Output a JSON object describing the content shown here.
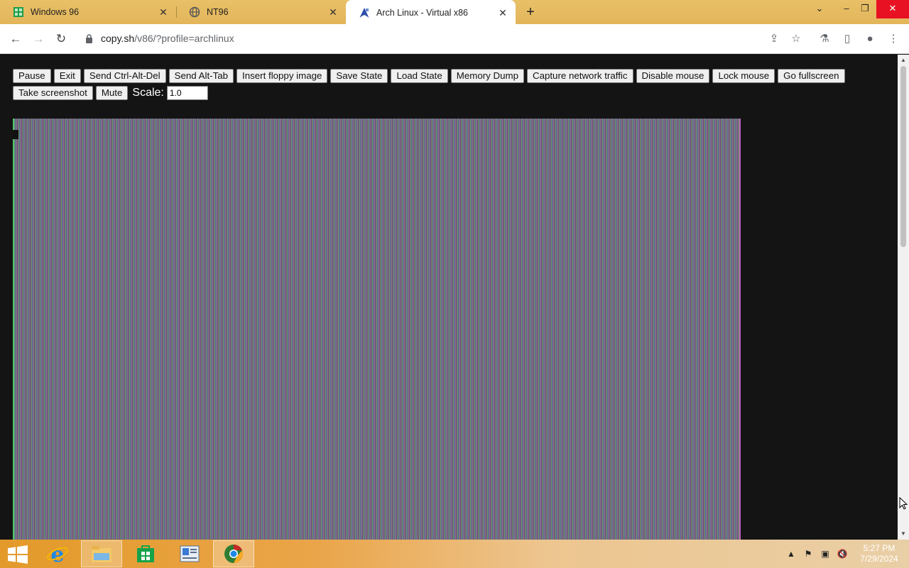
{
  "tabs": [
    {
      "title": "Windows 96",
      "favicon": "windows96-icon",
      "active": false
    },
    {
      "title": "NT96",
      "favicon": "globe-icon",
      "active": false
    },
    {
      "title": "Arch Linux - Virtual x86",
      "favicon": "arch-linux-icon",
      "active": true
    }
  ],
  "address": {
    "host": "copy.sh",
    "path": "/v86/?profile=archlinux"
  },
  "controls": {
    "pause": "Pause",
    "exit": "Exit",
    "send_ctrl_alt_del": "Send Ctrl-Alt-Del",
    "send_alt_tab": "Send Alt-Tab",
    "insert_floppy": "Insert floppy image",
    "save_state": "Save State",
    "load_state": "Load State",
    "memory_dump": "Memory Dump",
    "capture_network": "Capture network traffic",
    "disable_mouse": "Disable mouse",
    "lock_mouse": "Lock mouse",
    "go_fullscreen": "Go fullscreen",
    "take_screenshot": "Take screenshot",
    "mute": "Mute",
    "scale_label": "Scale:",
    "scale_value": "1.0"
  },
  "taskbar": {
    "apps": [
      "internet-explorer-icon",
      "file-explorer-icon",
      "store-icon",
      "news-icon",
      "chrome-icon"
    ]
  },
  "clock": {
    "time": "5:27 PM",
    "date": "7/29/2024"
  },
  "colors": {
    "tabbar": "#e6bb60",
    "page_bg": "#141414",
    "close_red": "#e81123"
  }
}
